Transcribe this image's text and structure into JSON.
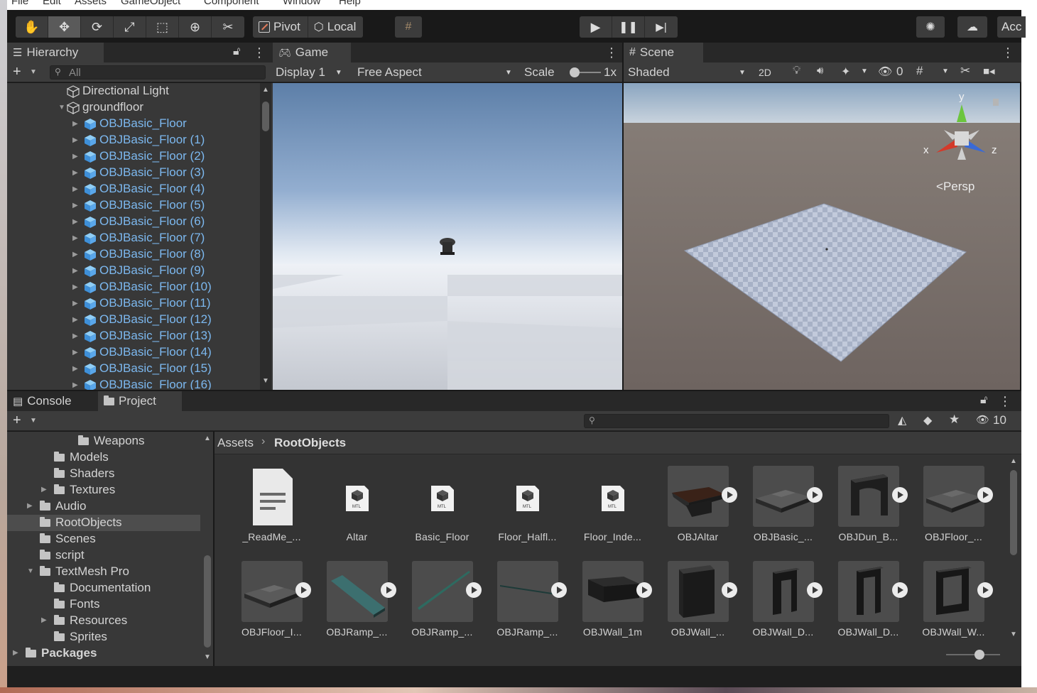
{
  "menu": [
    "File",
    "Edit",
    "Assets",
    "GameObject",
    "Component",
    "Window",
    "Help"
  ],
  "toolbar": {
    "pivot_label": "Pivot",
    "local_label": "Local",
    "account_label": "Acc"
  },
  "hierarchy": {
    "tab_label": "Hierarchy",
    "search_placeholder": "All",
    "items": [
      {
        "label": "Directional Light",
        "depth": 1,
        "expandable": false,
        "prefab": false
      },
      {
        "label": "groundfloor",
        "depth": 1,
        "expandable": true,
        "expanded": true,
        "prefab": false
      },
      {
        "label": "OBJBasic_Floor",
        "depth": 2,
        "expandable": true,
        "prefab": true
      },
      {
        "label": "OBJBasic_Floor (1)",
        "depth": 2,
        "expandable": true,
        "prefab": true
      },
      {
        "label": "OBJBasic_Floor (2)",
        "depth": 2,
        "expandable": true,
        "prefab": true
      },
      {
        "label": "OBJBasic_Floor (3)",
        "depth": 2,
        "expandable": true,
        "prefab": true
      },
      {
        "label": "OBJBasic_Floor (4)",
        "depth": 2,
        "expandable": true,
        "prefab": true
      },
      {
        "label": "OBJBasic_Floor (5)",
        "depth": 2,
        "expandable": true,
        "prefab": true
      },
      {
        "label": "OBJBasic_Floor (6)",
        "depth": 2,
        "expandable": true,
        "prefab": true
      },
      {
        "label": "OBJBasic_Floor (7)",
        "depth": 2,
        "expandable": true,
        "prefab": true
      },
      {
        "label": "OBJBasic_Floor (8)",
        "depth": 2,
        "expandable": true,
        "prefab": true
      },
      {
        "label": "OBJBasic_Floor (9)",
        "depth": 2,
        "expandable": true,
        "prefab": true
      },
      {
        "label": "OBJBasic_Floor (10)",
        "depth": 2,
        "expandable": true,
        "prefab": true
      },
      {
        "label": "OBJBasic_Floor (11)",
        "depth": 2,
        "expandable": true,
        "prefab": true
      },
      {
        "label": "OBJBasic_Floor (12)",
        "depth": 2,
        "expandable": true,
        "prefab": true
      },
      {
        "label": "OBJBasic_Floor (13)",
        "depth": 2,
        "expandable": true,
        "prefab": true
      },
      {
        "label": "OBJBasic_Floor (14)",
        "depth": 2,
        "expandable": true,
        "prefab": true
      },
      {
        "label": "OBJBasic_Floor (15)",
        "depth": 2,
        "expandable": true,
        "prefab": true
      },
      {
        "label": "OBJBasic_Floor (16)",
        "depth": 2,
        "expandable": true,
        "prefab": true
      }
    ]
  },
  "game": {
    "tab_label": "Game",
    "display_label": "Display 1",
    "aspect_label": "Free Aspect",
    "scale_label": "Scale",
    "scale_value": "1x"
  },
  "scene": {
    "tab_label": "Scene",
    "shading_label": "Shaded",
    "mode_2d_label": "2D",
    "hidden_count": "0",
    "persp_label": "Persp",
    "axis_x": "x",
    "axis_y": "y",
    "axis_z": "z"
  },
  "bottom": {
    "console_tab": "Console",
    "project_tab": "Project",
    "hidden_count": "10",
    "breadcrumb_root": "Assets",
    "breadcrumb_current": "RootObjects"
  },
  "project_tree": [
    {
      "label": "Weapons",
      "indent": 1,
      "arrow": false,
      "open": false,
      "selected": false,
      "bold": false
    },
    {
      "label": "Models",
      "indent": 0,
      "arrow": false,
      "open": false,
      "selected": false,
      "bold": false
    },
    {
      "label": "Shaders",
      "indent": 0,
      "arrow": false,
      "open": false,
      "selected": false,
      "bold": false
    },
    {
      "label": "Textures",
      "indent": 0,
      "arrow": true,
      "open": false,
      "selected": false,
      "bold": false
    },
    {
      "label": "Audio",
      "indent": -1,
      "arrow": true,
      "open": false,
      "selected": false,
      "bold": false
    },
    {
      "label": "RootObjects",
      "indent": -1,
      "arrow": false,
      "open": false,
      "selected": true,
      "bold": false
    },
    {
      "label": "Scenes",
      "indent": -1,
      "arrow": false,
      "open": false,
      "selected": false,
      "bold": false
    },
    {
      "label": "script",
      "indent": -1,
      "arrow": false,
      "open": false,
      "selected": false,
      "bold": false
    },
    {
      "label": "TextMesh Pro",
      "indent": -1,
      "arrow": true,
      "open": true,
      "selected": false,
      "bold": false
    },
    {
      "label": "Documentation",
      "indent": 0,
      "arrow": false,
      "open": false,
      "selected": false,
      "bold": false
    },
    {
      "label": "Fonts",
      "indent": 0,
      "arrow": false,
      "open": false,
      "selected": false,
      "bold": false
    },
    {
      "label": "Resources",
      "indent": 0,
      "arrow": true,
      "open": false,
      "selected": false,
      "bold": false
    },
    {
      "label": "Sprites",
      "indent": 0,
      "arrow": false,
      "open": false,
      "selected": false,
      "bold": false
    },
    {
      "label": "Packages",
      "indent": -2,
      "arrow": true,
      "open": false,
      "selected": false,
      "bold": true
    }
  ],
  "assets": [
    {
      "name": "_ReadMe_...",
      "kind": "doc"
    },
    {
      "name": "Altar",
      "kind": "mtl"
    },
    {
      "name": "Basic_Floor",
      "kind": "mtl"
    },
    {
      "name": "Floor_Halfl...",
      "kind": "mtl"
    },
    {
      "name": "Floor_Inde...",
      "kind": "mtl"
    },
    {
      "name": "OBJAltar",
      "kind": "model-altar"
    },
    {
      "name": "OBJBasic_...",
      "kind": "model-floor"
    },
    {
      "name": "OBJDun_B...",
      "kind": "model-arch"
    },
    {
      "name": "OBJFloor_...",
      "kind": "model-floor"
    },
    {
      "name": "OBJFloor_I...",
      "kind": "model-floor"
    },
    {
      "name": "OBJRamp_...",
      "kind": "model-ramp"
    },
    {
      "name": "OBJRamp_...",
      "kind": "model-rail"
    },
    {
      "name": "OBJRamp_...",
      "kind": "model-rail2"
    },
    {
      "name": "OBJWall_1m",
      "kind": "model-block"
    },
    {
      "name": "OBJWall_...",
      "kind": "model-wall"
    },
    {
      "name": "OBJWall_D...",
      "kind": "model-door"
    },
    {
      "name": "OBJWall_D...",
      "kind": "model-door2"
    },
    {
      "name": "OBJWall_W...",
      "kind": "model-window"
    }
  ],
  "colors": {
    "accent_blue": "#7cb8ef",
    "panel": "#383838",
    "selected_row": "#4d4d4d"
  }
}
